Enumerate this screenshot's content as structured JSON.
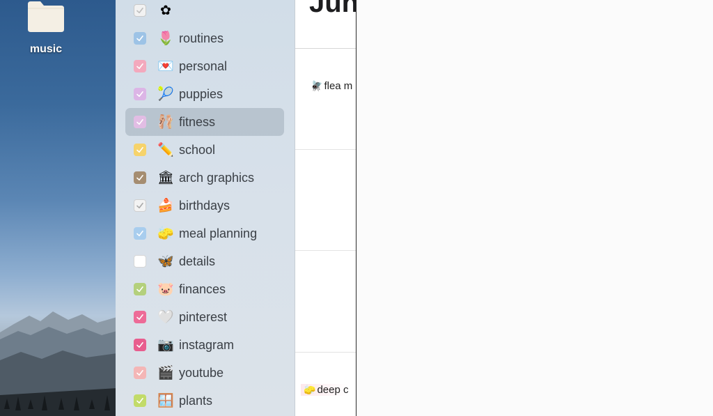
{
  "desktop": {
    "item": {
      "label": "music",
      "icon": "folder-icon"
    }
  },
  "sidebar": {
    "calendars": [
      {
        "emoji": "✿",
        "label": "",
        "color": "#f2f2f2",
        "border": "#c9c9c9",
        "checked": true,
        "check": "#bdbdbd"
      },
      {
        "emoji": "🌷",
        "label": "routines",
        "color": "#9dc3e6",
        "checked": true
      },
      {
        "emoji": "💌",
        "label": "personal",
        "color": "#f3a9bd",
        "checked": true
      },
      {
        "emoji": "🎾",
        "label": "puppies",
        "color": "#dcb5e6",
        "checked": true
      },
      {
        "emoji": "🩰",
        "label": "fitness",
        "color": "#e2bde4",
        "checked": true,
        "selected": true
      },
      {
        "emoji": "✏️",
        "label": "school",
        "color": "#f6d36b",
        "checked": true
      },
      {
        "emoji": "🏛",
        "label": "arch graphics",
        "color": "#a58d71",
        "checked": true
      },
      {
        "emoji": "🍰",
        "label": "birthdays",
        "color": "#f3f3f3",
        "border": "#cfcfcf",
        "checked": true,
        "check": "#a7a7a7"
      },
      {
        "emoji": "🧽",
        "label": "meal planning",
        "color": "#a8cdee",
        "checked": true
      },
      {
        "emoji": "🦋",
        "label": "details",
        "color": "#ffffff",
        "border": "#d6d6d6",
        "checked": false
      },
      {
        "emoji": "🐷",
        "label": "finances",
        "color": "#b4d07c",
        "checked": true
      },
      {
        "emoji": "🤍",
        "label": "pinterest",
        "color": "#ed6b97",
        "checked": true
      },
      {
        "emoji": "📷",
        "label": "instagram",
        "color": "#e85d8e",
        "checked": true
      },
      {
        "emoji": "🎬",
        "label": "youtube",
        "color": "#f4b6b6",
        "checked": true
      },
      {
        "emoji": "🪟",
        "label": "plants",
        "color": "#c2db69",
        "checked": true
      }
    ]
  },
  "main": {
    "title": "Jun",
    "events": [
      {
        "emoji": "🪰",
        "label": "flea m"
      },
      {
        "emoji": "🧽",
        "label": "deep c"
      }
    ]
  }
}
